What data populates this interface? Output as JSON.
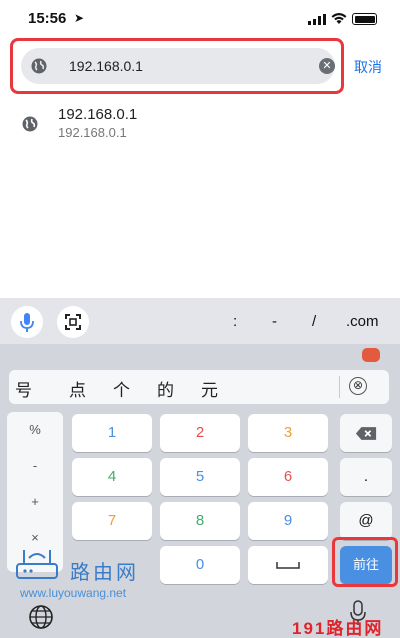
{
  "status_bar": {
    "time": "15:56",
    "location_icon": "location-arrow-icon",
    "signal_icon": "cellular-signal-icon",
    "wifi_icon": "wifi-icon",
    "battery_icon": "battery-icon"
  },
  "address_bar": {
    "value": "192.168.0.1",
    "site_icon": "globe-icon",
    "clear_icon": "clear-icon",
    "cancel_label": "取消",
    "highlight_color": "#e8383d"
  },
  "suggestion": {
    "icon": "globe-icon",
    "title": "192.168.0.1",
    "subtitle": "192.168.0.1"
  },
  "keyboard": {
    "toolbar": {
      "mic_icon": "microphone-icon",
      "scan_icon": "scan-icon",
      "symbols": [
        ":",
        "-",
        "/",
        ".com"
      ]
    },
    "candidates": [
      "号",
      "点",
      "个",
      "的",
      "元"
    ],
    "delete_label": "⊗",
    "side_symbols": [
      "%",
      "-",
      "+",
      "×"
    ],
    "digits": {
      "row1": [
        "1",
        "2",
        "3"
      ],
      "row2": [
        "4",
        "5",
        "6"
      ],
      "row3": [
        "7",
        "8",
        "9"
      ],
      "row4": [
        "0"
      ]
    },
    "digit_colors": {
      "1": "#4a90e2",
      "2": "#e25151",
      "3": "#f0a030",
      "4": "#3fae6a",
      "5": "#4a90e2",
      "6": "#e25151",
      "7": "#f0a030",
      "8": "#3fae6a",
      "9": "#4a90e2",
      "0": "#4a90e2"
    },
    "right_keys": {
      "backspace_icon": "backspace-icon",
      "dot": ".",
      "at": "@",
      "go_label": "前往"
    },
    "space_icon": "space-icon",
    "bottom": {
      "globe_icon": "globe-icon",
      "mic_icon": "microphone-icon"
    }
  },
  "watermark": {
    "logo_icon": "router-icon",
    "brand_text": "路由网",
    "url": "www.luyouwang.net",
    "site_text": "191路由网"
  }
}
